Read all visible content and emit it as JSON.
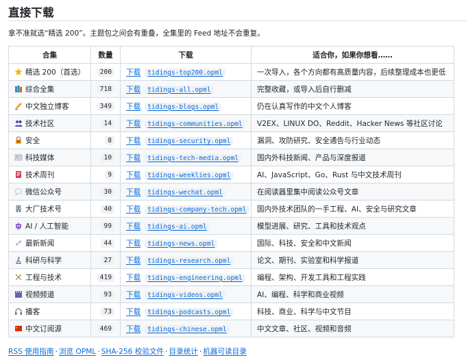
{
  "heading": "直接下载",
  "intro": "拿不准就选“精选 200”。主题包之间会有重叠，全集里的 Feed 地址不会重复。",
  "table": {
    "headers": [
      "合集",
      "数量",
      "下载",
      "适合你，如果你想看……"
    ],
    "rows": [
      {
        "icon": "star-icon",
        "color": "#f5b301",
        "name": "精选 200（首选）",
        "count": "200",
        "dl": "下载",
        "file": "tidings-top200.opml",
        "desc": "一次导入，各个方向都有高质量内容，后续整理成本也更低"
      },
      {
        "icon": "books-icon",
        "color": "#3b82f6",
        "name": "综合全集",
        "count": "718",
        "dl": "下载",
        "file": "tidings-all.opml",
        "desc": "完整收藏，或导入后自行删减"
      },
      {
        "icon": "writing-hand-icon",
        "color": "#f0a030",
        "name": "中文独立博客",
        "count": "349",
        "dl": "下载",
        "file": "tidings-blogs.opml",
        "desc": "仍在认真写作的中文个人博客"
      },
      {
        "icon": "people-icon",
        "color": "#5b4cb8",
        "name": "技术社区",
        "count": "14",
        "dl": "下载",
        "file": "tidings-communities.opml",
        "desc": "V2EX、LINUX DO、Reddit、Hacker News 等社区讨论"
      },
      {
        "icon": "lock-icon",
        "color": "#e0a020",
        "name": "安全",
        "count": "8",
        "dl": "下载",
        "file": "tidings-security.opml",
        "desc": "漏洞、攻防研究、安全通告与行业动态"
      },
      {
        "icon": "newspaper-icon",
        "color": "#9aa4b2",
        "name": "科技媒体",
        "count": "10",
        "dl": "下载",
        "file": "tidings-tech-media.opml",
        "desc": "国内外科技新闻、产品与深度报道"
      },
      {
        "icon": "bookmark-tabs-icon",
        "color": "#d83a52",
        "name": "技术周刊",
        "count": "9",
        "dl": "下载",
        "file": "tidings-weeklies.opml",
        "desc": "AI、JavaScript、Go、Rust 与中文技术周刊"
      },
      {
        "icon": "speech-bubble-icon",
        "color": "#b8c2cc",
        "name": "微信公众号",
        "count": "30",
        "dl": "下载",
        "file": "tidings-wechat.opml",
        "desc": "在阅读器里集中阅读公众号文章"
      },
      {
        "icon": "office-building-icon",
        "color": "#7a8fa6",
        "name": "大厂技术号",
        "count": "40",
        "dl": "下载",
        "file": "tidings-company-tech.opml",
        "desc": "国内外技术团队的一手工程、AI、安全与研究文章"
      },
      {
        "icon": "robot-icon",
        "color": "#8a5cc8",
        "name": "AI / 人工智能",
        "count": "99",
        "dl": "下载",
        "file": "tidings-ai.opml",
        "desc": "模型进展、研究、工具和技术观点"
      },
      {
        "icon": "satellite-icon",
        "color": "#a0a8b4",
        "name": "最新新闻",
        "count": "44",
        "dl": "下载",
        "file": "tidings-news.opml",
        "desc": "国际、科技、安全和中文新闻"
      },
      {
        "icon": "microscope-icon",
        "color": "#5a8fd0",
        "name": "科研与科学",
        "count": "27",
        "dl": "下载",
        "file": "tidings-research.opml",
        "desc": "论文、期刊、实验室和科学报道"
      },
      {
        "icon": "tools-icon",
        "color": "#8a93a0",
        "name": "工程与技术",
        "count": "419",
        "dl": "下载",
        "file": "tidings-engineering.opml",
        "desc": "编程、架构、开发工具和工程实践"
      },
      {
        "icon": "clapper-icon",
        "color": "#6b5ac8",
        "name": "视频频道",
        "count": "93",
        "dl": "下载",
        "file": "tidings-videos.opml",
        "desc": "AI、编程、科学和商业视频"
      },
      {
        "icon": "headphones-icon",
        "color": "#6c757d",
        "name": "播客",
        "count": "73",
        "dl": "下载",
        "file": "tidings-podcasts.opml",
        "desc": "科技、商业、科学与中文节目"
      },
      {
        "icon": "flag-icon",
        "color": "#de2910",
        "name": "中文订阅源",
        "count": "469",
        "dl": "下载",
        "file": "tidings-chinese.opml",
        "desc": "中文文章、社区、视频和音频"
      }
    ]
  },
  "footer": {
    "links": [
      "RSS 使用指南",
      "浏览 OPML",
      "SHA-256 校验文件",
      "目录统计",
      "机器可读目录"
    ],
    "separator": "·"
  }
}
